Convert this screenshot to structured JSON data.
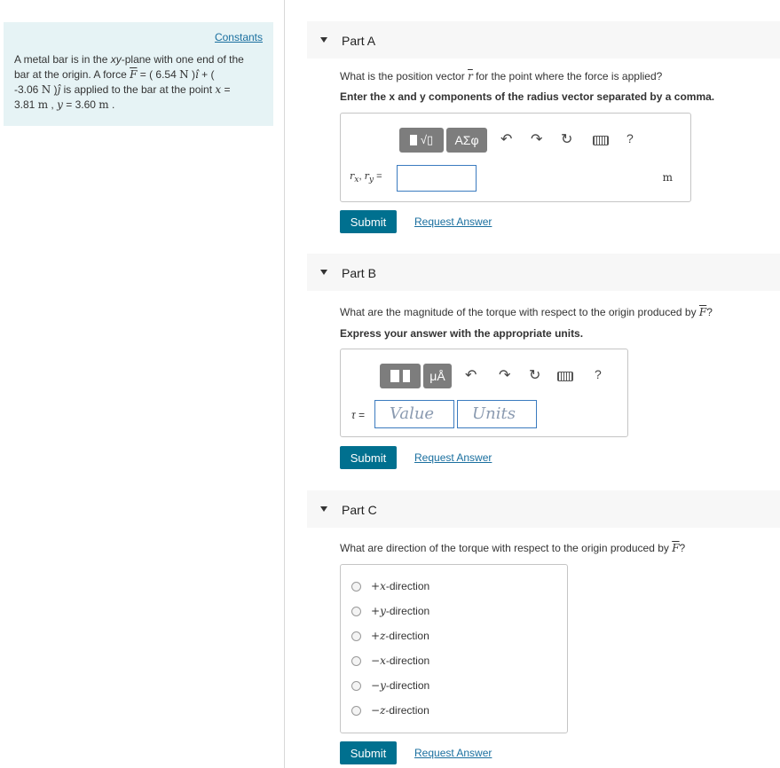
{
  "sidebar": {
    "constants_label": "Constants",
    "problem": {
      "line1": "A metal bar is in the ",
      "xy": "xy",
      "line1b": "-plane with one end of the",
      "line2": "bar at the origin. A force ",
      "F": "F",
      "eq": " = ( 6.54 ",
      "N": "N",
      "paren": " )",
      "i": "î",
      "plus": " + (",
      "line3": "-3.06 ",
      "N3": "N",
      "paren3": " )",
      "j": "ĵ",
      "line3b": " is applied to the bar at the point ",
      "x": "x",
      "eq3": " =",
      "line4": "3.81 ",
      "m1": "m",
      "comma": " , ",
      "y": "y",
      "eq4": " = 3.60 ",
      "m2": "m",
      "dot": " ."
    }
  },
  "partA": {
    "title": "Part A",
    "question_pre": "What is the position vector ",
    "question_var": "r",
    "question_post": " for the point where the force is applied?",
    "instruction": "Enter the x and y components of the radius vector separated by a comma.",
    "toolbar_greek": "ΑΣφ",
    "help": "?",
    "label_rx": "r",
    "label_x_sub": "x",
    "label_comma": ", ",
    "label_ry": "r",
    "label_y_sub": "y",
    "label_eq": " =",
    "input_value": "",
    "unit": "m",
    "submit": "Submit",
    "request": "Request Answer"
  },
  "partB": {
    "title": "Part B",
    "question_pre": "What are the magnitude of the torque with respect to the origin produced by ",
    "question_var": "F",
    "question_post": "?",
    "instruction": "Express your answer with the appropriate units.",
    "toolbar_units": "μÅ",
    "help": "?",
    "tau_label": "τ =",
    "value_placeholder": "Value",
    "units_placeholder": "Units",
    "submit": "Submit",
    "request": "Request Answer"
  },
  "partC": {
    "title": "Part C",
    "question_pre": "What are direction of the torque with respect to the origin produced by ",
    "question_var": "F",
    "question_post": "?",
    "options": [
      {
        "sign": "+",
        "axis": "x",
        "label": "-direction"
      },
      {
        "sign": "+",
        "axis": "y",
        "label": "-direction"
      },
      {
        "sign": "+",
        "axis": "z",
        "label": "-direction"
      },
      {
        "sign": "−",
        "axis": "x",
        "label": "-direction"
      },
      {
        "sign": "−",
        "axis": "y",
        "label": "-direction"
      },
      {
        "sign": "−",
        "axis": "z",
        "label": "-direction"
      }
    ],
    "submit": "Submit",
    "request": "Request Answer"
  },
  "colors": {
    "accent": "#00708f",
    "link": "#1a6f9f",
    "sidebar_bg": "#e6f3f5"
  }
}
